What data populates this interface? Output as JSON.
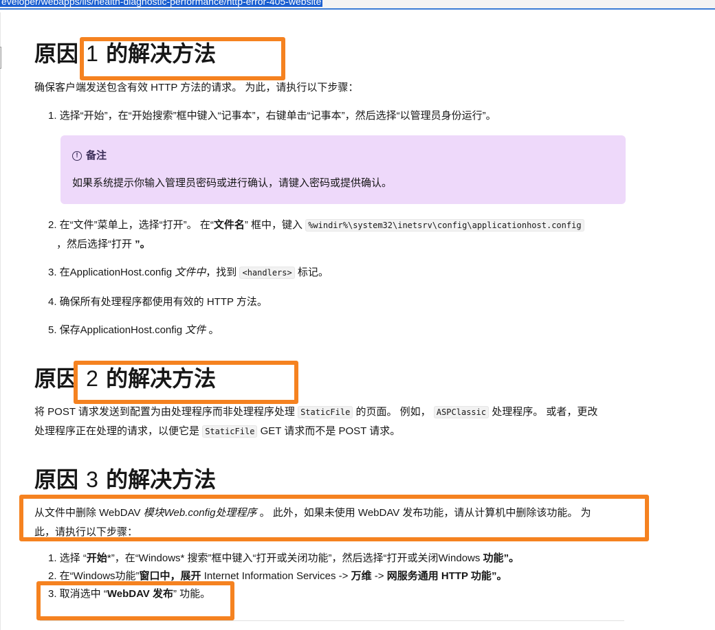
{
  "url": "eveloper/webapps/iis/health-diagnostic-performance/http-error-405-website",
  "section1": {
    "heading_prefix": "原因",
    "heading_num": "1",
    "heading_suffix": "的解决方法",
    "intro": "确保客户端发送包含有效 HTTP 方法的请求。 为此，请执行以下步骤：",
    "step1": "1. 选择“开始”，在“开始搜索”框中键入“记事本”，右键单击“记事本”，然后选择“以管理员身份运行”。",
    "note_title": "备注",
    "note_body": "如果系统提示你输入管理员密码或进行确认，请键入密码或提供确认。",
    "step2_a": "2. 在“文件”菜单上，选择“打开”。 在“",
    "step2_bold": "文件名",
    "step2_b": "” 框中，键入",
    "step2_code": "%windir%\\system32\\inetsrv\\config\\applicationhost.config",
    "step2_c": "，然后选择“打开",
    "step2_d": " ”。",
    "step3_a": "3. 在ApplicationHost.config",
    "step3_em": "文件中",
    "step3_b": "，找到",
    "step3_code": "<handlers>",
    "step3_c": "标记。",
    "step4": "4. 确保所有处理程序都使用有效的 HTTP 方法。",
    "step5_a": "5. 保存ApplicationHost.config",
    "step5_em": "文件",
    "step5_b": "。"
  },
  "section2": {
    "heading_prefix": "原因",
    "heading_num": "2",
    "heading_suffix": "的解决方法",
    "p_a": "将 POST 请求发送到配置为由处理程序而非处理程序处理",
    "code1": "StaticFile",
    "p_b": "的页面。 例如，",
    "code2": "ASPClassic",
    "p_c": "处理程序。 或者，更改",
    "p_d": "处理程序正在处理的请求，以便它是",
    "code3": "StaticFile",
    "p_e": "GET 请求而不是 POST 请求。"
  },
  "section3": {
    "heading_prefix": "原因",
    "heading_num": "3",
    "heading_suffix": "的解决方法",
    "p_a": "从文件中删除 WebDAV",
    "p_em": "模块Web.config处理程序",
    "p_b": "。 此外，如果未使用 WebDAV 发布功能，请从计算机中删除该功能。 为",
    "p_c": "此，请执行以下步骤：",
    "step1_a": "1. 选择 “",
    "step1_bold1": "开始",
    "step1_b": "*”，在“Windows* 搜索”框中键入“打开或关闭功能”，然后选择“打开或关闭Windows",
    "step1_bold2": "功能",
    "step1_c": "”。",
    "step2_a": "2. 在“Windows功能”",
    "step2_bold1": "窗口中，展开",
    "step2_b": "Internet Information Services ->",
    "step2_bold2": "万维",
    "step2_c": "->",
    "step2_bold3": "网服务通用 HTTP 功能",
    "step2_d": "”。",
    "step3_a": "3. 取消选中 “",
    "step3_bold": "WebDAV 发布",
    "step3_b": "” 功能。"
  },
  "colors": {
    "highlight": "#f58220",
    "note_bg": "#eed9fa",
    "url_selection": "#1a5fd1"
  }
}
